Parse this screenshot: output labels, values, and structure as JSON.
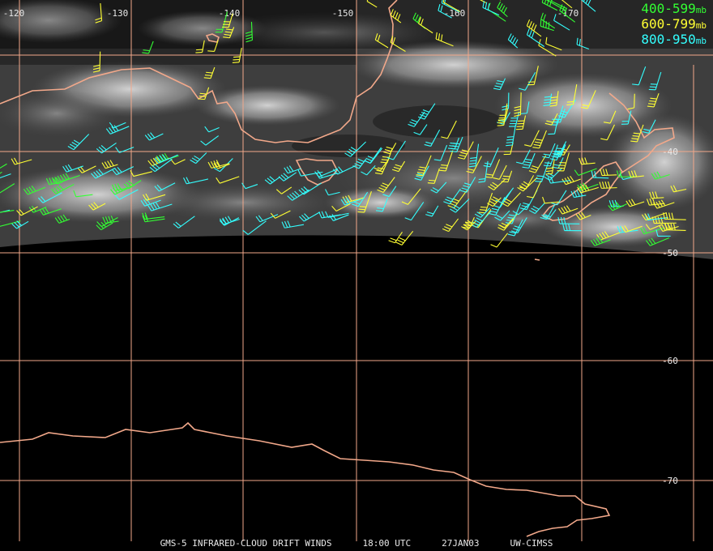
{
  "grid": {
    "longitude_labels": [
      "-120",
      "-130",
      "-140",
      "-150",
      "-160",
      "-170"
    ],
    "latitude_labels": [
      "-40",
      "-50",
      "-60",
      "-70"
    ],
    "line_color": "#f2a88a"
  },
  "coast_color": "#f2a88a",
  "legend": [
    {
      "range": "400-599",
      "unit": "mb",
      "color": "#33ff33"
    },
    {
      "range": "600-799",
      "unit": "mb",
      "color": "#ffff33"
    },
    {
      "range": "800-950",
      "unit": "mb",
      "color": "#33ffff"
    }
  ],
  "footer": {
    "product": "GMS-5 INFRARED-CLOUD DRIFT WINDS",
    "time": "18:00 UTC",
    "date": "27JAN03",
    "credit": "UW-CIMSS"
  }
}
